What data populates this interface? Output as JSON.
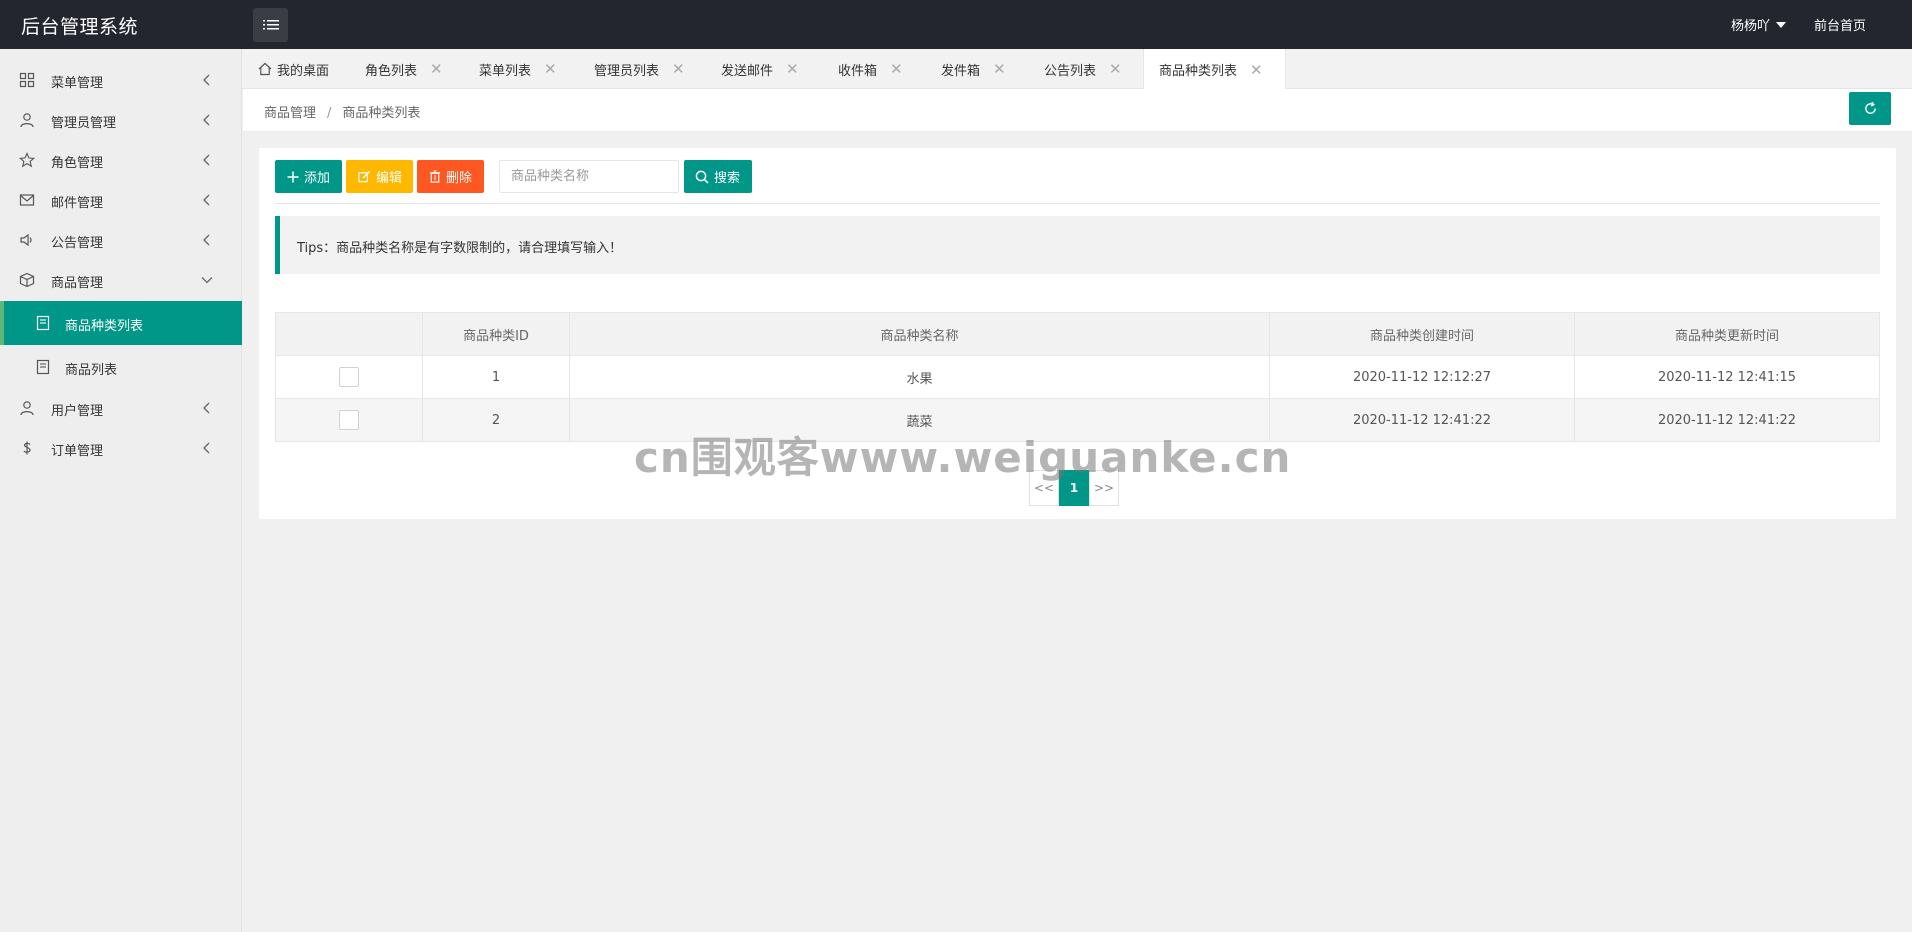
{
  "header": {
    "title": "后台管理系统",
    "user": "杨杨吖",
    "front_link": "前台首页"
  },
  "sidebar": {
    "items": [
      {
        "label": "菜单管理",
        "icon": "grid-icon"
      },
      {
        "label": "管理员管理",
        "icon": "user-icon"
      },
      {
        "label": "角色管理",
        "icon": "star-icon"
      },
      {
        "label": "邮件管理",
        "icon": "mail-icon"
      },
      {
        "label": "公告管理",
        "icon": "speaker-icon"
      },
      {
        "label": "商品管理",
        "icon": "box-icon"
      },
      {
        "label": "用户管理",
        "icon": "user-icon"
      },
      {
        "label": "订单管理",
        "icon": "dollar-icon"
      }
    ],
    "sub_items": [
      {
        "label": "商品种类列表",
        "active": true
      },
      {
        "label": "商品列表",
        "active": false
      }
    ]
  },
  "tabs": [
    {
      "label": "我的桌面"
    },
    {
      "label": "角色列表"
    },
    {
      "label": "菜单列表"
    },
    {
      "label": "管理员列表"
    },
    {
      "label": "发送邮件"
    },
    {
      "label": "收件箱"
    },
    {
      "label": "发件箱"
    },
    {
      "label": "公告列表"
    },
    {
      "label": "商品种类列表",
      "active": true
    }
  ],
  "breadcrumb": {
    "parent": "商品管理",
    "separator": "/",
    "current": "商品种类列表"
  },
  "toolbar": {
    "add_label": "添加",
    "edit_label": "编辑",
    "delete_label": "删除",
    "search_placeholder": "商品种类名称",
    "search_label": "搜索"
  },
  "tips": "Tips：商品种类名称是有字数限制的，请合理填写输入！",
  "table": {
    "headers": [
      "",
      "商品种类ID",
      "商品种类名称",
      "商品种类创建时间",
      "商品种类更新时间"
    ],
    "rows": [
      {
        "id": "1",
        "name": "水果",
        "created": "2020-11-12 12:12:27",
        "updated": "2020-11-12 12:41:15"
      },
      {
        "id": "2",
        "name": "蔬菜",
        "created": "2020-11-12 12:41:22",
        "updated": "2020-11-12 12:41:22"
      }
    ]
  },
  "pagination": {
    "prev": "<<",
    "current": "1",
    "next": ">>"
  },
  "watermark": "cn围观客www.weiguanke.cn",
  "colors": {
    "primary": "#009688",
    "warning": "#ffb800",
    "danger": "#ff5722",
    "header_bg": "#23262e"
  }
}
